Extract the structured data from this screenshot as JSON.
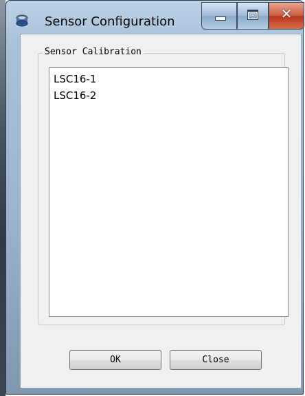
{
  "window": {
    "title": "Sensor Configuration",
    "icon": "sensor-app-icon",
    "controls": {
      "minimize": "minimize-icon",
      "maximize": "maximize-icon",
      "close": "close-icon"
    }
  },
  "group": {
    "label": "Sensor Calibration"
  },
  "sensors": [
    {
      "label": "LSC16-1"
    },
    {
      "label": "LSC16-2"
    }
  ],
  "buttons": {
    "ok_label": "OK",
    "close_label": "Close"
  },
  "colors": {
    "close_button": "#c95a3f",
    "title_bar": "#bcd1e5"
  }
}
